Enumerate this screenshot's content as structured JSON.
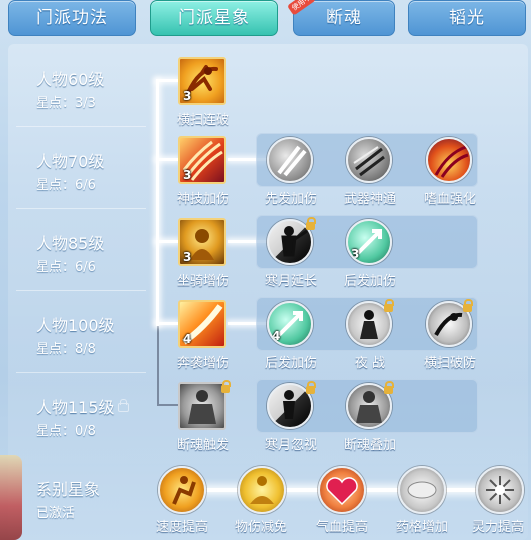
{
  "tabs": [
    {
      "label": "门派功法",
      "active": false
    },
    {
      "label": "门派星象",
      "active": true
    },
    {
      "label": "断魂",
      "active": false,
      "badge": "使用中"
    },
    {
      "label": "韬光",
      "active": false
    }
  ],
  "rows": [
    {
      "level": "人物60级",
      "stars": "星点：3/3"
    },
    {
      "level": "人物70级",
      "stars": "星点：6/6"
    },
    {
      "level": "人物85级",
      "stars": "星点：6/6"
    },
    {
      "level": "人物100级",
      "stars": "星点：8/8"
    },
    {
      "level": "人物115级",
      "stars": "星点：0/8",
      "locked": true
    }
  ],
  "nodes": {
    "r1_main": {
      "name": "横扫连破",
      "level": "3"
    },
    "r2_main": {
      "name": "神技加伤",
      "level": "3"
    },
    "r2_a": {
      "name": "先发加伤"
    },
    "r2_b": {
      "name": "武器神通"
    },
    "r2_c": {
      "name": "嗜血强化"
    },
    "r3_main": {
      "name": "坐骑增伤",
      "level": "3"
    },
    "r3_a": {
      "name": "寒月延长"
    },
    "r3_b": {
      "name": "后发加伤",
      "level": "3"
    },
    "r4_main": {
      "name": "奔袭增伤",
      "level": "4"
    },
    "r4_a": {
      "name": "后发加伤",
      "level": "4"
    },
    "r4_b": {
      "name": "夜 战"
    },
    "r4_c": {
      "name": "横扫破防"
    },
    "r5_main": {
      "name": "断魂触发"
    },
    "r5_a": {
      "name": "寒月忽视"
    },
    "r5_b": {
      "name": "断魂叠加"
    }
  },
  "series": {
    "title": "系别星象",
    "status": "已激活",
    "items": [
      {
        "name": "速度提高"
      },
      {
        "name": "物伤减免"
      },
      {
        "name": "气血提高"
      },
      {
        "name": "药格增加"
      },
      {
        "name": "灵力提高"
      }
    ]
  }
}
